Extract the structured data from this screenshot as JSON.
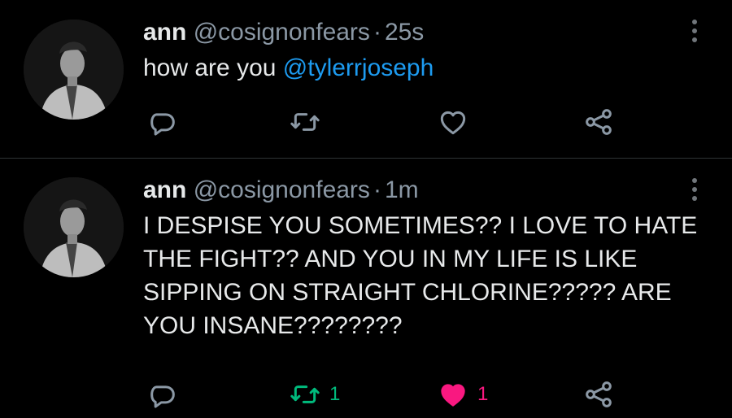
{
  "colors": {
    "background": "#000000",
    "text": "#e7e9ea",
    "muted": "#8b98a5",
    "mention": "#1d9bf0",
    "retweet_active": "#00ba7c",
    "like_active": "#f91880",
    "divider": "#2f3336"
  },
  "tweets": [
    {
      "name": "ann",
      "handle": "@cosignonfears",
      "separator": "·",
      "time": "25s",
      "text_before": "how are you ",
      "mention": "@tylerrjoseph",
      "text_after": "",
      "actions": {
        "reply_icon": "reply-icon",
        "retweet_icon": "retweet-icon",
        "like_icon": "heart-outline-icon",
        "share_icon": "share-icon",
        "retweet_count": "",
        "like_count": ""
      }
    },
    {
      "name": "ann",
      "handle": "@cosignonfears",
      "separator": "·",
      "time": "1m",
      "text_before": "I DESPISE YOU SOMETIMES?? I LOVE TO HATE THE FIGHT?? AND YOU IN MY LIFE IS LIKE SIPPING ON STRAIGHT CHLORINE????? ARE YOU INSANE????????",
      "mention": "",
      "text_after": "",
      "actions": {
        "reply_icon": "reply-icon",
        "retweet_icon": "retweet-icon",
        "like_icon": "heart-filled-icon",
        "share_icon": "share-icon",
        "retweet_count": "1",
        "like_count": "1"
      }
    }
  ]
}
